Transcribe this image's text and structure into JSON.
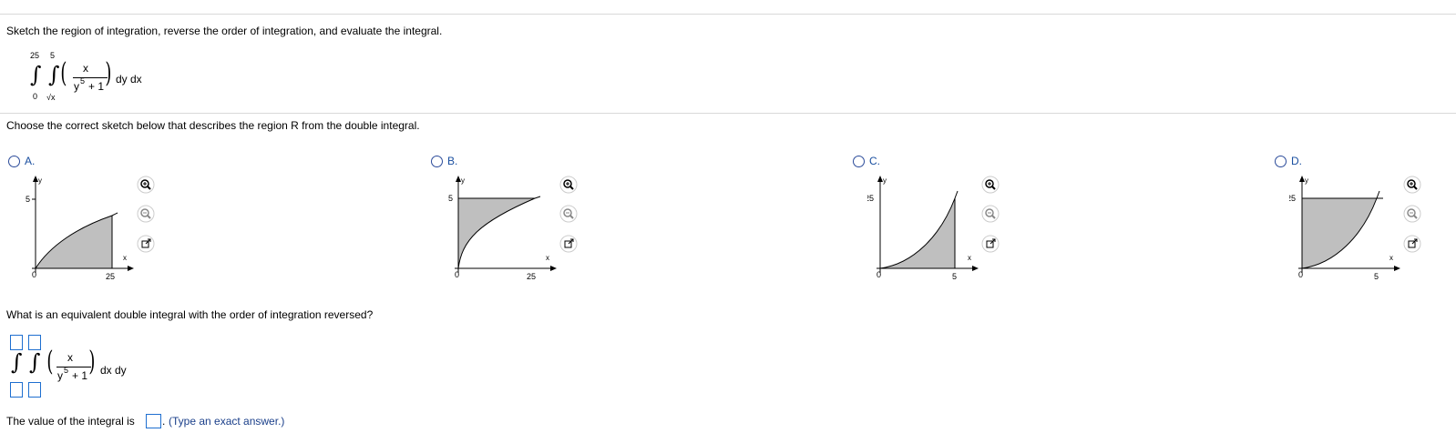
{
  "problem": {
    "instruction": "Sketch the region of integration, reverse the order of integration, and evaluate the integral.",
    "outer_upper": "25",
    "outer_lower": "0",
    "inner_upper": "5",
    "inner_lower": "√x",
    "numerator": "x",
    "denominator_base": "y",
    "denominator_exp": "5",
    "denominator_rest": "+ 1",
    "differentials": "dy dx"
  },
  "question1": {
    "prompt": "Choose the correct sketch below that describes the region R from the double integral.",
    "options": [
      {
        "letter": "A.",
        "ylabel": "y",
        "xlabel": "x",
        "ytick": "5",
        "xtick": "25",
        "origin": "0"
      },
      {
        "letter": "B.",
        "ylabel": "y",
        "xlabel": "x",
        "ytick": "5",
        "xtick": "25",
        "origin": "0"
      },
      {
        "letter": "C.",
        "ylabel": "y",
        "xlabel": "x",
        "ytick": "25",
        "xtick": "5",
        "origin": "0"
      },
      {
        "letter": "D.",
        "ylabel": "y",
        "xlabel": "x",
        "ytick": "25",
        "xtick": "5",
        "origin": "0"
      }
    ],
    "icons": [
      "zoom-in-icon",
      "zoom-out-icon",
      "open-external-icon"
    ]
  },
  "question2": {
    "prompt": "What is an equivalent double integral with the order of integration reversed?",
    "numerator": "x",
    "denominator_base": "y",
    "denominator_exp": "5",
    "denominator_rest": "+ 1",
    "differentials": "dx dy"
  },
  "question3": {
    "prefix": "The value of the integral is",
    "suffix": ".",
    "hint": "(Type an exact answer.)"
  },
  "colors": {
    "region_fill": "#bfbfbf",
    "accent": "#1e6fd0",
    "option_letter": "#1a4fa0"
  }
}
